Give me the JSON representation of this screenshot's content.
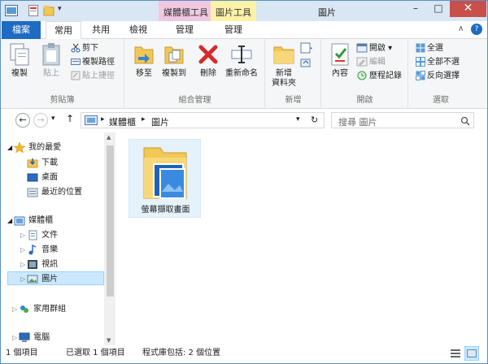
{
  "titlebar": {
    "title": "圖片",
    "context_media": "媒體櫃工具",
    "context_picture": "圖片工具",
    "minimize": "–",
    "maximize": "□",
    "close": "✕"
  },
  "tabs": {
    "file": "檔案",
    "home": "常用",
    "share": "共用",
    "view": "檢視",
    "manage_library": "管理",
    "manage_picture": "管理"
  },
  "ribbon": {
    "clipboard": {
      "label": "剪貼簿",
      "copy": "複製",
      "paste": "貼上",
      "cut": "剪下",
      "copy_path": "複製路徑",
      "paste_shortcut": "貼上捷徑"
    },
    "organize": {
      "label": "組合管理",
      "move_to": "移至",
      "copy_to": "複製到",
      "delete": "刪除",
      "rename": "重新命名"
    },
    "new": {
      "label": "新增",
      "new_folder": "新增\n資料夾"
    },
    "open": {
      "label": "開啟",
      "properties": "內容",
      "open": "開啟",
      "edit": "編輯",
      "history": "歷程記錄"
    },
    "select": {
      "label": "選取",
      "select_all": "全選",
      "select_none": "全部不選",
      "invert": "反向選擇"
    }
  },
  "address": {
    "crumb1": "媒體櫃",
    "crumb2": "圖片",
    "search_placeholder": "搜尋 圖片"
  },
  "nav": {
    "favorites": "我的最愛",
    "downloads": "下載",
    "desktop": "桌面",
    "recent": "最近的位置",
    "libraries": "媒體櫃",
    "documents": "文件",
    "music": "音樂",
    "videos": "視訊",
    "pictures": "圖片",
    "homegroup": "家用群組",
    "computer": "電腦"
  },
  "content": {
    "folder_name": "螢幕擷取畫面"
  },
  "status": {
    "items": "1 個項目",
    "selected": "已選取 1 個項目",
    "library": "程式庫包括: 2 個位置"
  },
  "colors": {
    "file_tab": "#1e6bc1",
    "close_button": "#c7504a",
    "selection": "#cce8ff",
    "context_media": "#f0c8e0",
    "context_picture": "#fdf2a8"
  }
}
